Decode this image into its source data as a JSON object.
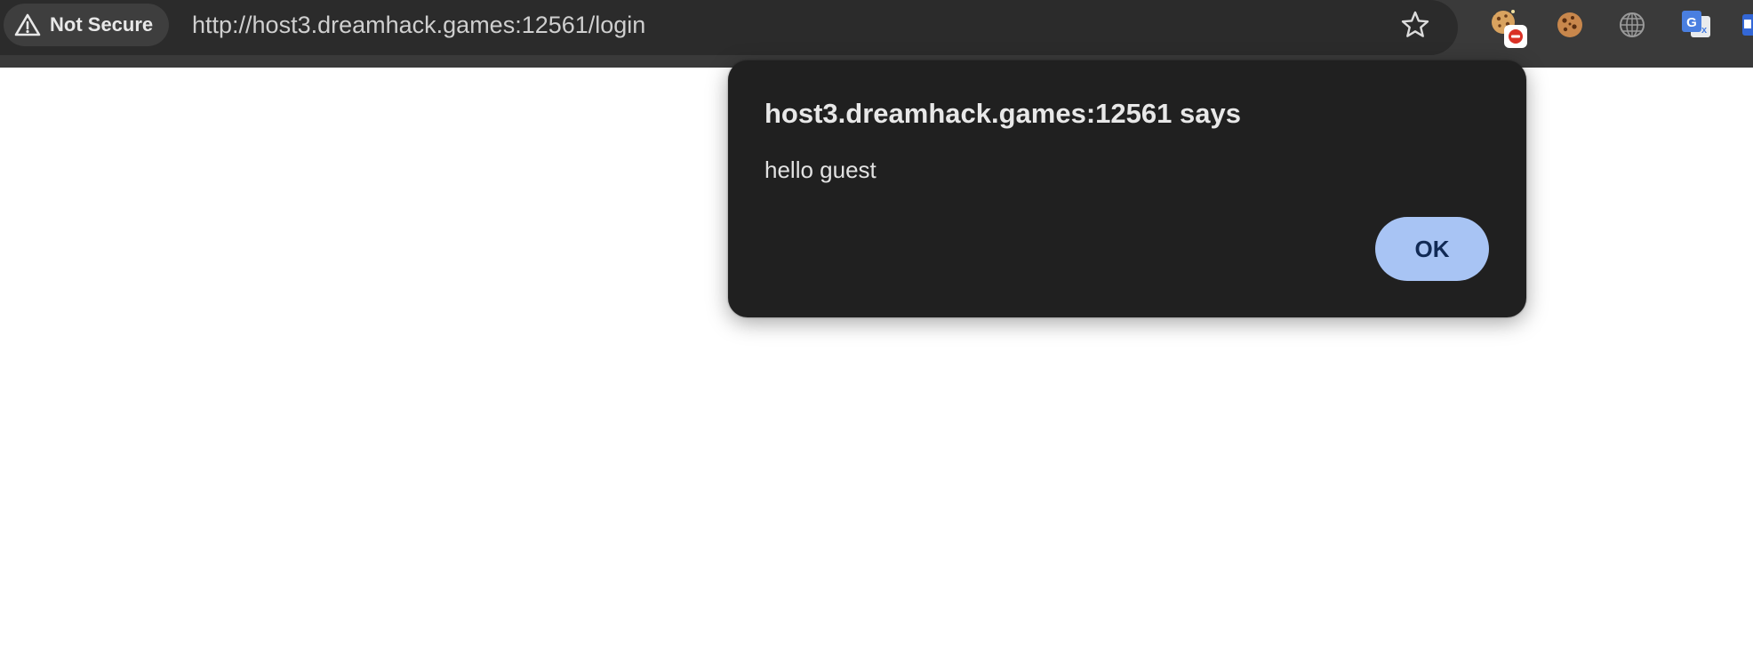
{
  "browser": {
    "security_label": "Not Secure",
    "url": "http://host3.dreamhack.games:12561/login",
    "bar_color": "#3a3a3a",
    "omnibox_color": "#2b2b2b",
    "extensions": [
      {
        "icon": "cookie-editor-blocked-icon"
      },
      {
        "icon": "cookie-icon"
      },
      {
        "icon": "globe-grid-icon"
      },
      {
        "icon": "google-translate-icon"
      },
      {
        "icon": "extension-partial-icon"
      }
    ]
  },
  "dialog": {
    "title": "host3.dreamhack.games:12561 says",
    "message": "hello guest",
    "ok_label": "OK",
    "background": "#202020",
    "button_color": "#a8c4f4"
  }
}
